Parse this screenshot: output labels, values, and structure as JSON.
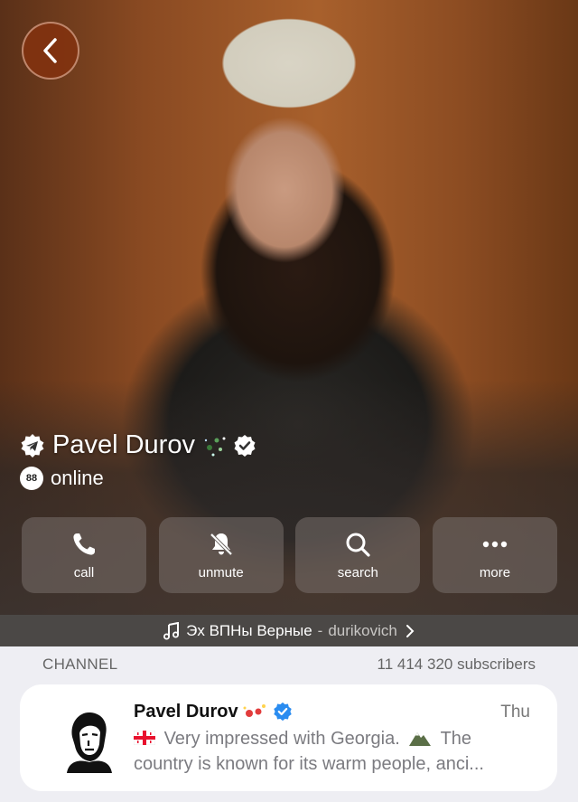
{
  "profile": {
    "name": "Pavel Durov",
    "status_badge": "88",
    "status": "online"
  },
  "actions": [
    {
      "label": "call",
      "icon": "phone-icon"
    },
    {
      "label": "unmute",
      "icon": "bell-slash-icon"
    },
    {
      "label": "search",
      "icon": "search-icon"
    },
    {
      "label": "more",
      "icon": "more-dots-icon"
    }
  ],
  "music": {
    "title": "Эх ВПНы Верные",
    "separator": "-",
    "artist": "durikovich"
  },
  "channel_section": {
    "label": "CHANNEL",
    "subscribers": "11 414 320 subscribers"
  },
  "channel_card": {
    "name": "Pavel Durov",
    "date": "Thu",
    "preview_line1": "Very impressed with Georgia.",
    "preview_line1_end": "The",
    "preview_line2": "country is known for its warm people, anci..."
  },
  "colors": {
    "accent_blue": "#2a8cf0",
    "back_button": "#82320f"
  }
}
